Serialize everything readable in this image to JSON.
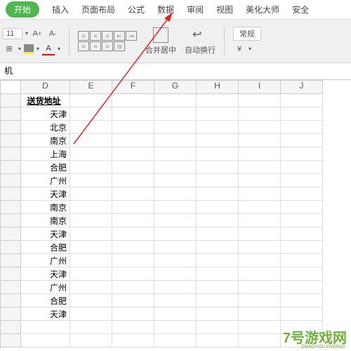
{
  "tabs": {
    "start": "开始",
    "insert": "插入",
    "layout": "页面布局",
    "formula": "公式",
    "data": "数据",
    "review": "审阅",
    "view": "视图",
    "beautify": "美化大师",
    "security": "安全"
  },
  "toolbar": {
    "font_size": "11",
    "merge_center": "合并居中",
    "wrap_text": "自动换行",
    "format_default": "常规"
  },
  "formula_bar": "机",
  "columns": [
    "D",
    "E",
    "F",
    "G",
    "H",
    "I",
    "J"
  ],
  "header_cell": "送货地址",
  "cells_d": [
    "天津",
    "北京",
    "南京",
    "上海",
    "合肥",
    "广州",
    "天津",
    "南京",
    "南京",
    "天津",
    "合肥",
    "广州",
    "天津",
    "广州",
    "合肥",
    "天津"
  ],
  "watermark": {
    "main": "7号游戏网",
    "sub": "ZHAOYOUXIWANG"
  },
  "colors": {
    "tab_active": "#4eb74e",
    "arrow": "#e3221f"
  }
}
